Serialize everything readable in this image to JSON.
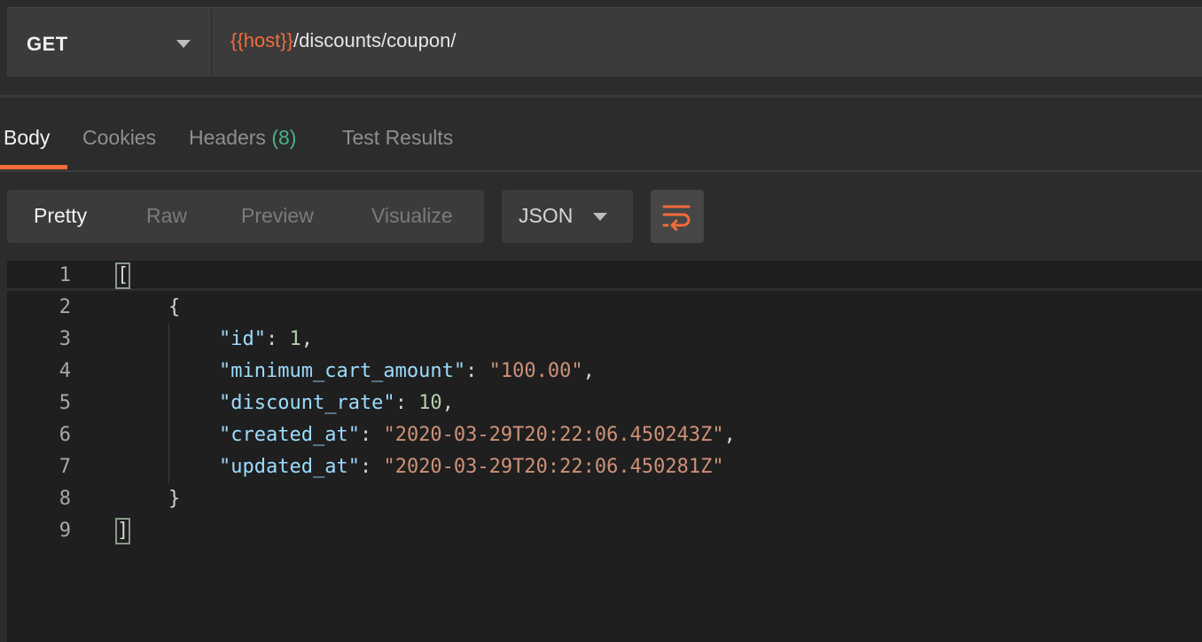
{
  "request": {
    "method": "GET",
    "url_variable": "{{host}}",
    "url_path": "/discounts/coupon/"
  },
  "response_tabs": [
    {
      "label": "Body"
    },
    {
      "label": "Cookies"
    },
    {
      "label": "Headers",
      "count": "(8)"
    },
    {
      "label": "Test Results"
    }
  ],
  "body_toolbar": {
    "views": [
      "Pretty",
      "Raw",
      "Preview",
      "Visualize"
    ],
    "format": "JSON",
    "wrap_icon": "wrap-lines-icon"
  },
  "editor": {
    "line_numbers": [
      "1",
      "2",
      "3",
      "4",
      "5",
      "6",
      "7",
      "8",
      "9"
    ],
    "open_bracket": "[",
    "open_brace": "{",
    "fields": [
      {
        "key": "\"id\"",
        "value": "1",
        "type": "number",
        "trail": ","
      },
      {
        "key": "\"minimum_cart_amount\"",
        "value": "\"100.00\"",
        "type": "string",
        "trail": ","
      },
      {
        "key": "\"discount_rate\"",
        "value": "10",
        "type": "number",
        "trail": ","
      },
      {
        "key": "\"created_at\"",
        "value": "\"2020-03-29T20:22:06.450243Z\"",
        "type": "string",
        "trail": ","
      },
      {
        "key": "\"updated_at\"",
        "value": "\"2020-03-29T20:22:06.450281Z\"",
        "type": "string",
        "trail": ""
      }
    ],
    "close_brace": "}",
    "close_bracket": "]"
  },
  "colors": {
    "accent": "#f26b3a",
    "count_green": "#4ab087",
    "json_key": "#9cdcfe",
    "json_string": "#ce9178",
    "json_number": "#b5cea8"
  }
}
